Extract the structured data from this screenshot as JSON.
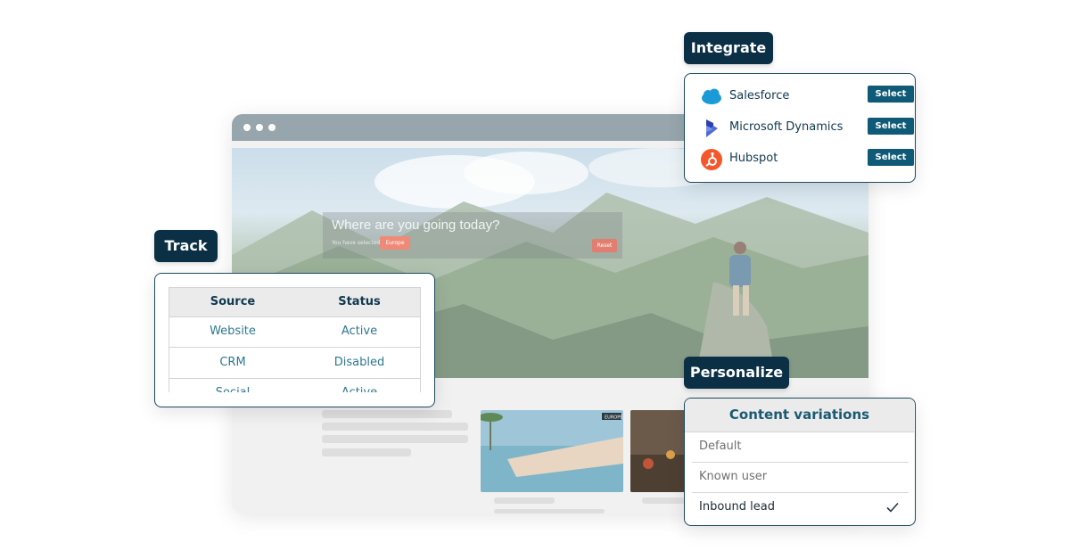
{
  "browser": {
    "hero": {
      "search_title": "Where are you going today?",
      "search_sub": "You have selected",
      "chip_label": "Europe",
      "reset_label": "Reset"
    },
    "card_badge": "EUROPE"
  },
  "integrate": {
    "tag": "Integrate",
    "items": [
      {
        "label": "Salesforce",
        "icon": "salesforce-cloud-icon",
        "button": "Select"
      },
      {
        "label": "Microsoft Dynamics",
        "icon": "microsoft-dynamics-icon",
        "button": "Select"
      },
      {
        "label": "Hubspot",
        "icon": "hubspot-sprocket-icon",
        "button": "Select"
      }
    ]
  },
  "track": {
    "tag": "Track",
    "columns": [
      "Source",
      "Status"
    ],
    "rows": [
      [
        "Website",
        "Active"
      ],
      [
        "CRM",
        "Disabled"
      ],
      [
        "Social",
        "Active"
      ]
    ]
  },
  "personalize": {
    "tag": "Personalize",
    "header": "Content variations",
    "options": [
      {
        "label": "Default",
        "selected": false
      },
      {
        "label": "Known user",
        "selected": false
      },
      {
        "label": "Inbound lead",
        "selected": true
      }
    ]
  },
  "colors": {
    "navy": "#0b3045",
    "teal_button": "#0f5a77",
    "salesforce": "#1a9bd7",
    "hubspot": "#f4572b",
    "dynamics": "#3f4fc6"
  }
}
